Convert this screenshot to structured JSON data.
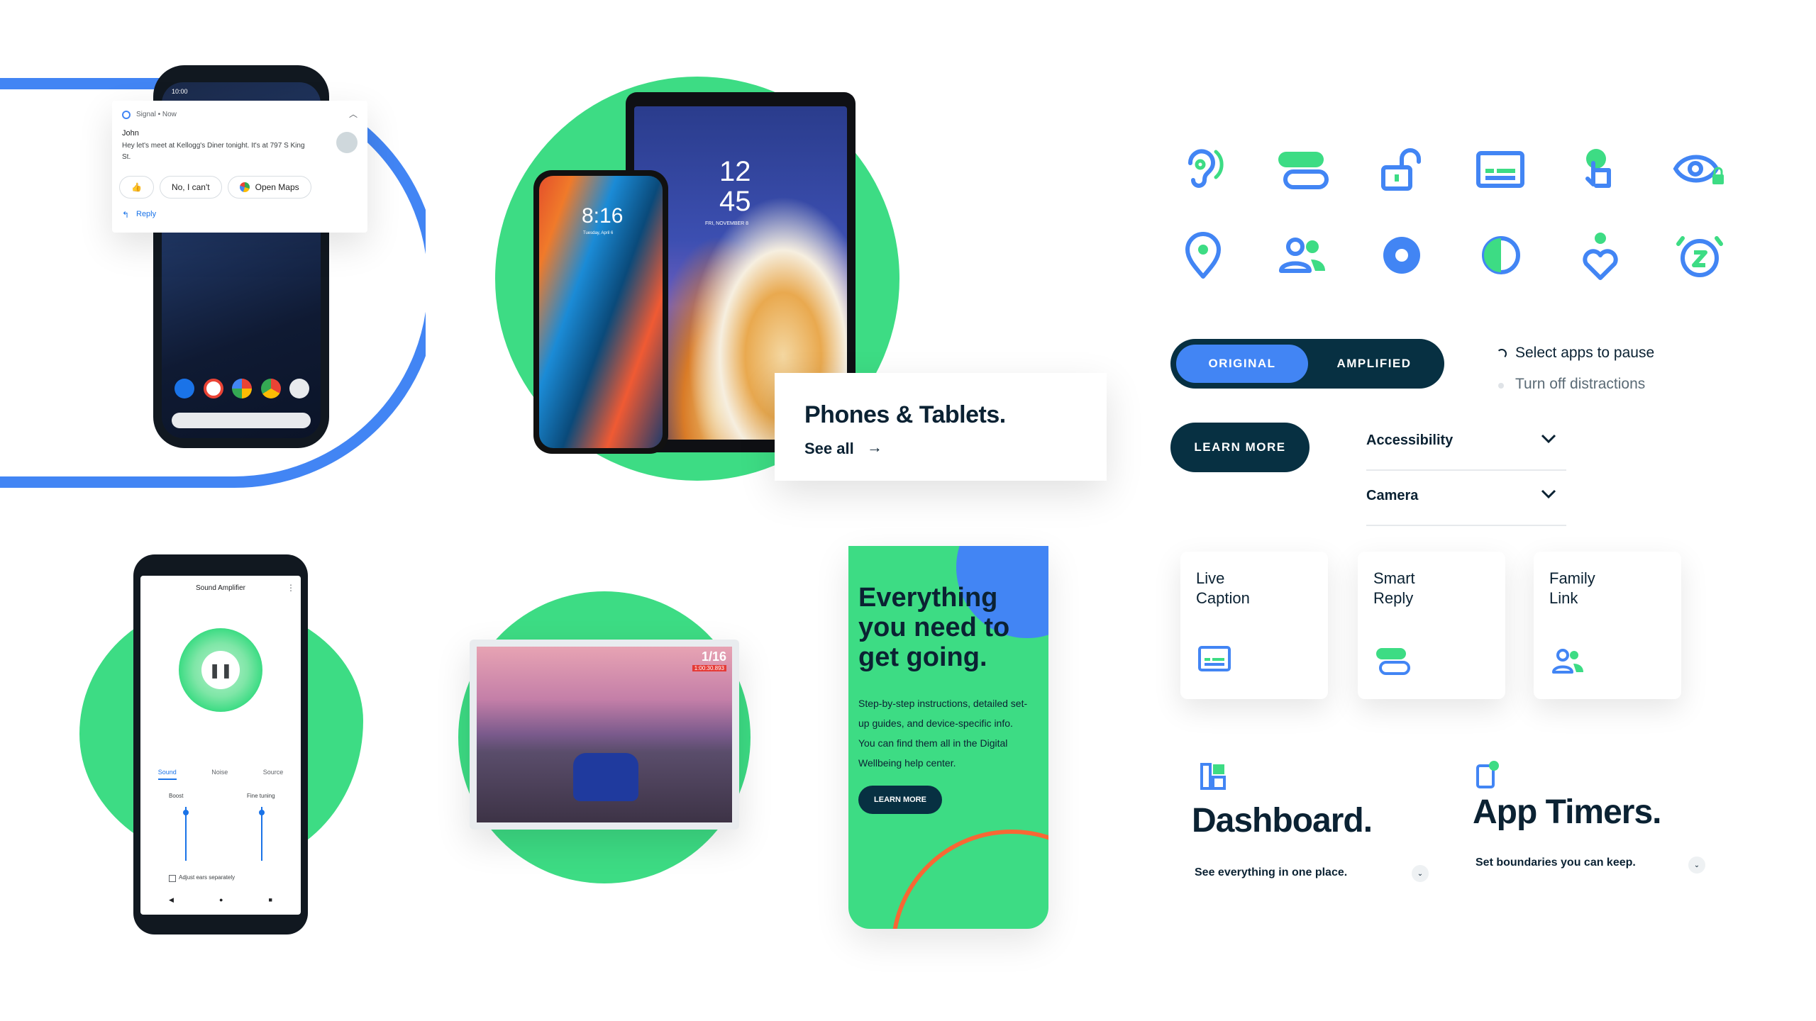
{
  "notification": {
    "app": "Signal • Now",
    "sender": "John",
    "message": "Hey let's meet at Kellogg's Diner tonight. It's at 797 S King St.",
    "actions": [
      "No, I can't",
      "Open Maps"
    ],
    "reply": "Reply",
    "status_time": "10:00"
  },
  "devices": {
    "phone_time": "8:16",
    "phone_date": "Tuesday, April 6",
    "tablet_time_h": "12",
    "tablet_time_m": "45",
    "tablet_date": "FRI, NOVEMBER 8"
  },
  "phones_card": {
    "title": "Phones & Tablets.",
    "link": "See all"
  },
  "sound_amplifier": {
    "title": "Sound Amplifier",
    "tabs": [
      "Sound",
      "Noise",
      "Source"
    ],
    "boost": "Boost",
    "fine_tuning": "Fine tuning",
    "adjust": "Adjust ears separately"
  },
  "game": {
    "rank": "1/16",
    "timer": "1:00:30.893"
  },
  "promo": {
    "title": "Everything you need to get going.",
    "body": "Step-by-step instructions, detailed set-up guides, and device-specific info. You can find them all in the Digital Wellbeing help center.",
    "button": "LEARN MORE"
  },
  "icons": [
    "ear-icon",
    "toggle-icon",
    "unlock-icon",
    "caption-icon",
    "touch-icon",
    "eye-lock-icon",
    "location-pin-icon",
    "people-icon",
    "record-icon",
    "contrast-icon",
    "heart-pin-icon",
    "snooze-icon"
  ],
  "toggle": {
    "left": "ORIGINAL",
    "right": "AMPLIFIED",
    "active": "ORIGINAL"
  },
  "radio": {
    "options": [
      "Select apps to pause",
      "Turn off distractions"
    ],
    "selected": 0
  },
  "learn_more": "LEARN MORE",
  "dropdowns": [
    "Accessibility",
    "Camera"
  ],
  "feature_cards": [
    {
      "label": "Live\nCaption",
      "icon": "caption-icon"
    },
    {
      "label": "Smart\nReply",
      "icon": "toggle-icon"
    },
    {
      "label": "Family\nLink",
      "icon": "people-icon"
    }
  ],
  "dashboard": {
    "title": "Dashboard.",
    "subtitle": "See everything in one place."
  },
  "app_timers": {
    "title": "App Timers.",
    "subtitle": "Set boundaries you can keep."
  },
  "colors": {
    "green": "#3ddc84",
    "blue": "#4285f4",
    "navy": "#073042",
    "orange": "#f86734"
  }
}
